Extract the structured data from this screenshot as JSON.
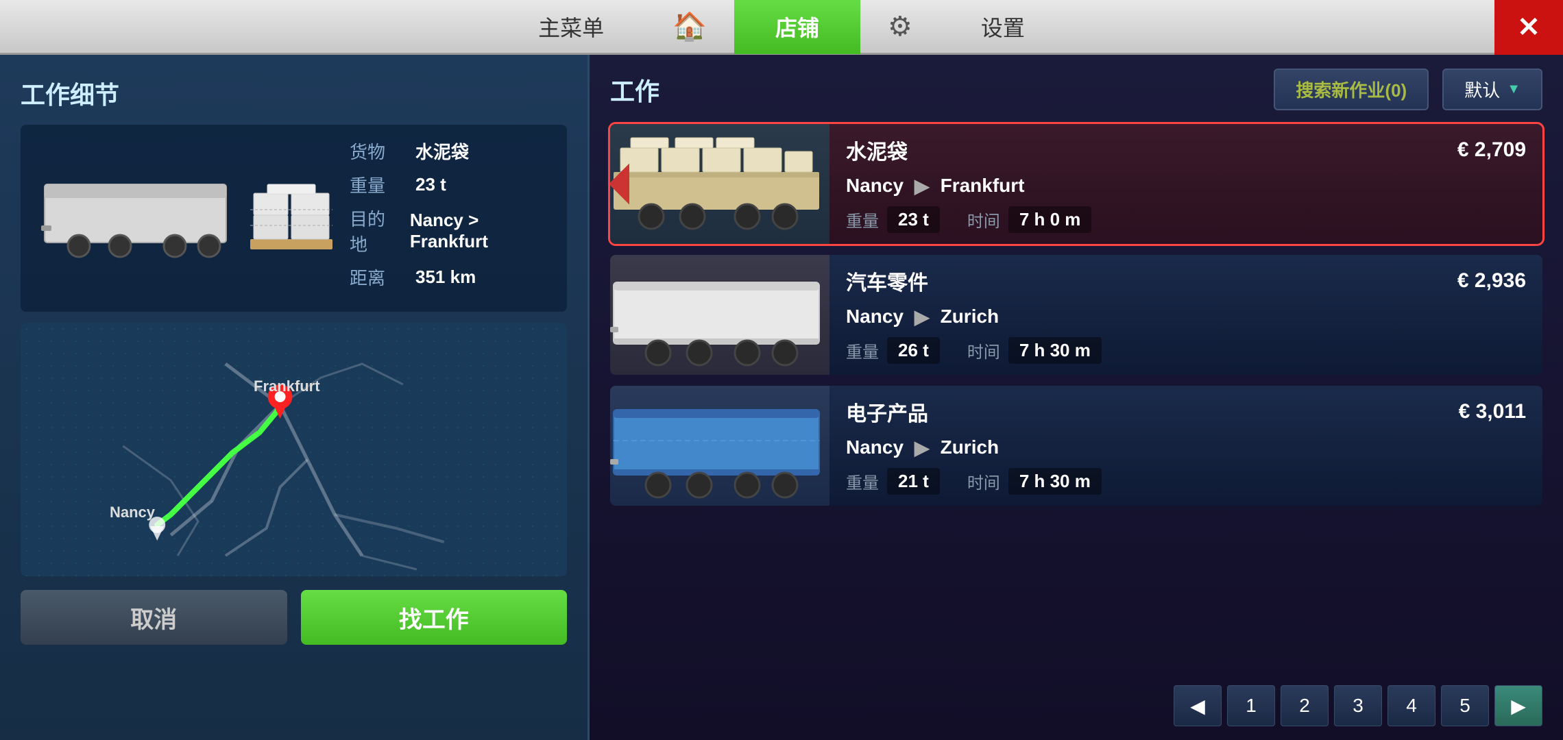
{
  "nav": {
    "main_menu": "主菜单",
    "home_icon": "🏠",
    "shop": "店铺",
    "settings_icon": "⚙",
    "settings": "设置",
    "close": "✕"
  },
  "left_panel": {
    "title": "工作细节",
    "cargo_label": "货物",
    "cargo_value": "水泥袋",
    "weight_label": "重量",
    "weight_value": "23 t",
    "dest_label": "目的地",
    "dest_value": "Nancy > Frankfurt",
    "dist_label": "距离",
    "dist_value": "351 km",
    "from_city": "Nancy",
    "to_city": "Frankfurt",
    "cancel_btn": "取消",
    "find_btn": "找工作"
  },
  "right_panel": {
    "title": "工作",
    "search_btn": "搜索新作业(0)",
    "default_btn": "默认",
    "jobs": [
      {
        "cargo": "水泥袋",
        "price": "€ 2,709",
        "from": "Nancy",
        "to": "Frankfurt",
        "weight": "23 t",
        "time": "7 h 0 m",
        "trailer_type": "flatbed",
        "selected": true
      },
      {
        "cargo": "汽车零件",
        "price": "€ 2,936",
        "from": "Nancy",
        "to": "Zurich",
        "weight": "26 t",
        "time": "7 h 30 m",
        "trailer_type": "box",
        "selected": false
      },
      {
        "cargo": "电子产品",
        "price": "€ 3,011",
        "from": "Nancy",
        "to": "Zurich",
        "weight": "21 t",
        "time": "7 h 30 m",
        "trailer_type": "blue_box",
        "selected": false
      }
    ],
    "pages": [
      "◀",
      "1",
      "2",
      "3",
      "4",
      "5",
      "▶"
    ]
  }
}
